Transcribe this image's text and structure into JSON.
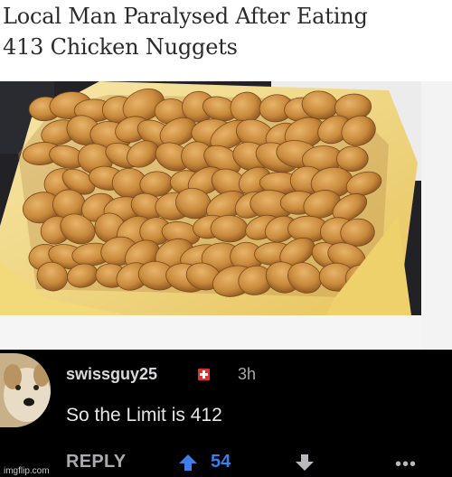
{
  "article": {
    "headline_line1": "Local Man Paralysed After Eating",
    "headline_line2": "413 Chicken Nuggets"
  },
  "comment": {
    "username": "swissguy25",
    "flair_icon": "swiss-flag-icon",
    "timestamp": "3h",
    "body": "So the Limit is 412",
    "reply_label": "REPLY",
    "vote_count": "54",
    "more_label": "•••"
  },
  "watermark": "imgflip.com",
  "colors": {
    "comment_bg": "#000000",
    "vote_blue": "#3d7fe6",
    "flag_red": "#e03131"
  }
}
